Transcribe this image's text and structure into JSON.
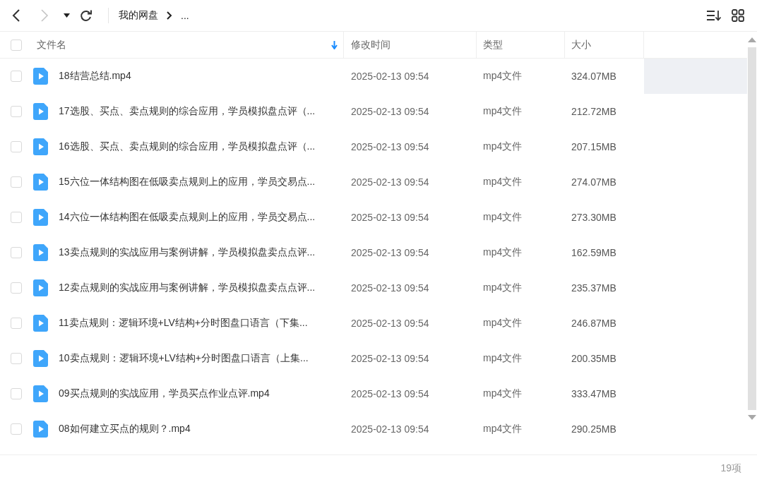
{
  "toolbar": {
    "breadcrumb": [
      {
        "label": "我的网盘"
      },
      {
        "label": "..."
      }
    ],
    "forward_disabled": true
  },
  "table": {
    "select_all": {
      "checked": false
    },
    "columns": [
      {
        "label": "文件名",
        "sorted": true
      },
      {
        "label": "修改时间",
        "sorted": false
      },
      {
        "label": "类型",
        "sorted": false
      },
      {
        "label": "大小",
        "sorted": false
      }
    ],
    "rows": [
      {
        "name": "18结营总结.mp4",
        "modified": "2025-02-13 09:54",
        "type": "mp4文件",
        "size": "324.07MB",
        "checked": false,
        "hovered": true
      },
      {
        "name": "17选股、买点、卖点规则的综合应用，学员模拟盘点评（...",
        "modified": "2025-02-13 09:54",
        "type": "mp4文件",
        "size": "212.72MB",
        "checked": false,
        "hovered": false
      },
      {
        "name": "16选股、买点、卖点规则的综合应用，学员模拟盘点评（...",
        "modified": "2025-02-13 09:54",
        "type": "mp4文件",
        "size": "207.15MB",
        "checked": false,
        "hovered": false
      },
      {
        "name": "15六位一体结构图在低吸卖点规则上的应用，学员交易点...",
        "modified": "2025-02-13 09:54",
        "type": "mp4文件",
        "size": "274.07MB",
        "checked": false,
        "hovered": false
      },
      {
        "name": "14六位一体结构图在低吸卖点规则上的应用，学员交易点...",
        "modified": "2025-02-13 09:54",
        "type": "mp4文件",
        "size": "273.30MB",
        "checked": false,
        "hovered": false
      },
      {
        "name": "13卖点规则的实战应用与案例讲解，学员模拟盘卖点点评...",
        "modified": "2025-02-13 09:54",
        "type": "mp4文件",
        "size": "162.59MB",
        "checked": false,
        "hovered": false
      },
      {
        "name": "12卖点规则的实战应用与案例讲解，学员模拟盘卖点点评...",
        "modified": "2025-02-13 09:54",
        "type": "mp4文件",
        "size": "235.37MB",
        "checked": false,
        "hovered": false
      },
      {
        "name": "11卖点规则：逻辑环境+LV结构+分时图盘口语言（下集...",
        "modified": "2025-02-13 09:54",
        "type": "mp4文件",
        "size": "246.87MB",
        "checked": false,
        "hovered": false
      },
      {
        "name": "10卖点规则：逻辑环境+LV结构+分时图盘口语言（上集...",
        "modified": "2025-02-13 09:54",
        "type": "mp4文件",
        "size": "200.35MB",
        "checked": false,
        "hovered": false
      },
      {
        "name": "09买点规则的实战应用，学员买点作业点评.mp4",
        "modified": "2025-02-13 09:54",
        "type": "mp4文件",
        "size": "333.47MB",
        "checked": false,
        "hovered": false
      },
      {
        "name": "08如何建立买点的规则？.mp4",
        "modified": "2025-02-13 09:54",
        "type": "mp4文件",
        "size": "290.25MB",
        "checked": false,
        "hovered": false
      }
    ]
  },
  "status_bar": {
    "count": "19项"
  }
}
